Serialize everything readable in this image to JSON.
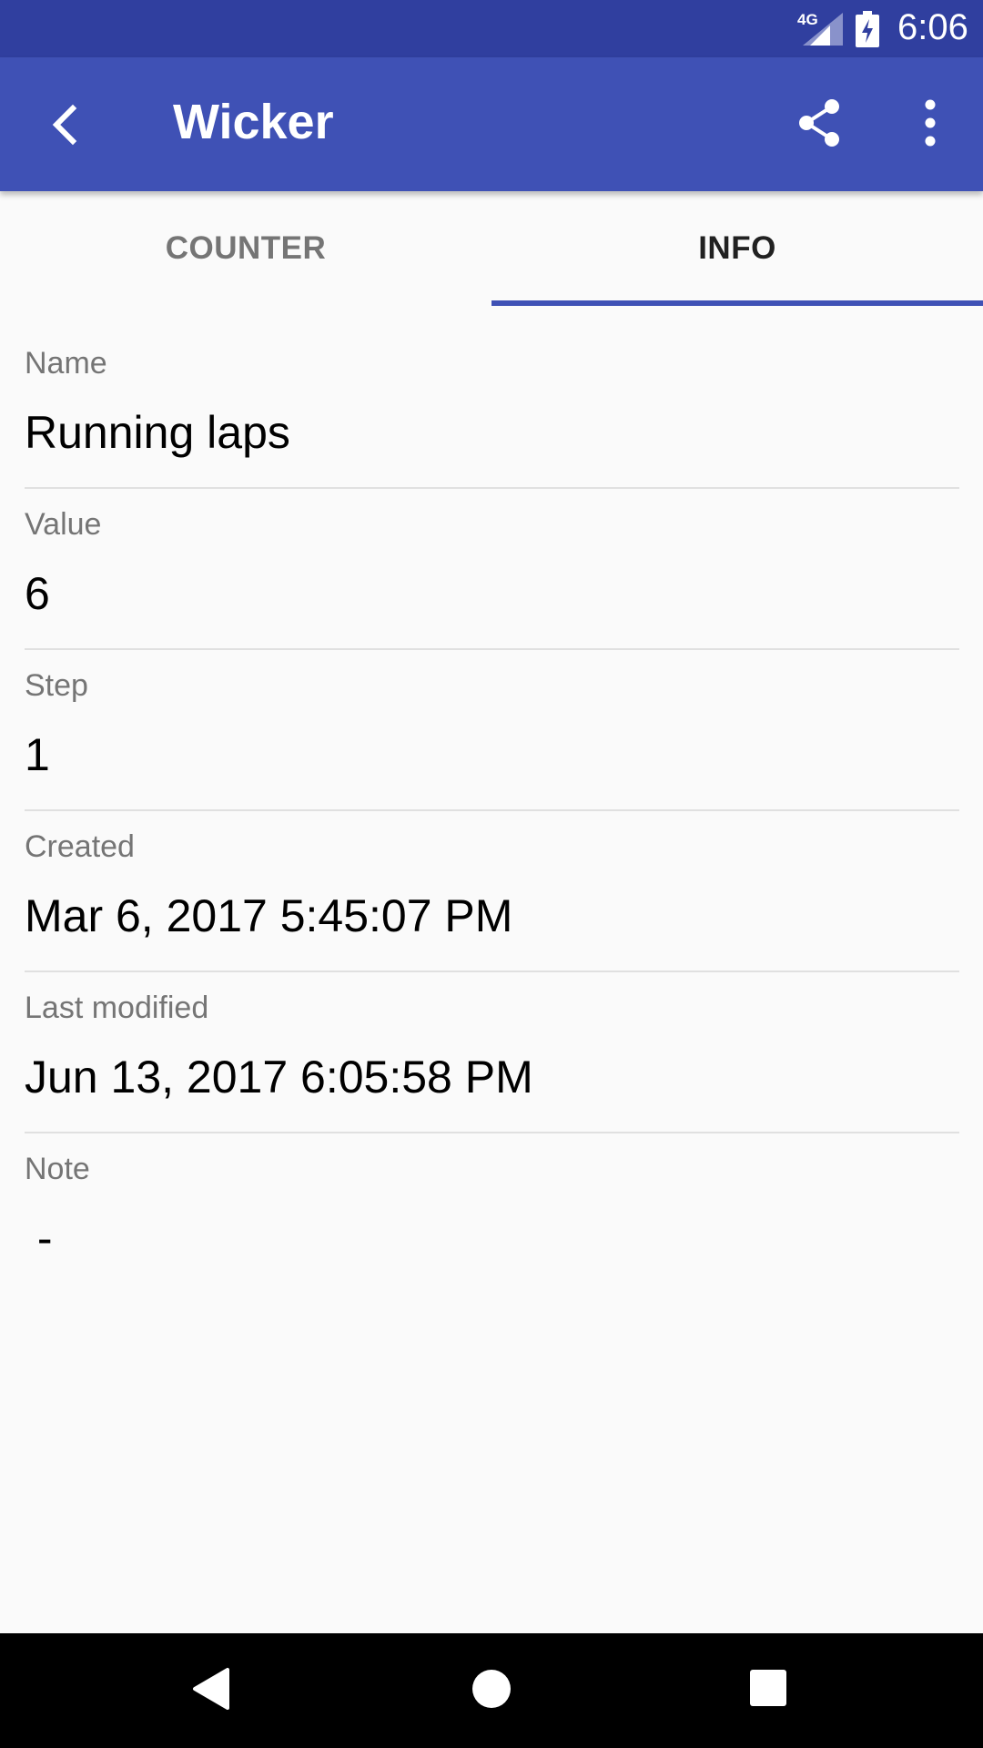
{
  "status_bar": {
    "network_label": "4G",
    "time": "6:06",
    "icons": [
      "signal-icon",
      "battery-charging-icon"
    ]
  },
  "app_bar": {
    "title": "Wicker",
    "icons": [
      "back-arrow-icon",
      "share-icon",
      "more-vert-icon"
    ],
    "background": "#3f51b5"
  },
  "tabs": [
    {
      "label": "COUNTER",
      "selected": false
    },
    {
      "label": "INFO",
      "selected": true
    }
  ],
  "fields": [
    {
      "label": "Name",
      "value": "Running laps"
    },
    {
      "label": "Value",
      "value": "6"
    },
    {
      "label": "Step",
      "value": "1"
    },
    {
      "label": "Created",
      "value": "Mar 6, 2017 5:45:07 PM"
    },
    {
      "label": "Last modified",
      "value": "Jun 13, 2017 6:05:58 PM"
    },
    {
      "label": "Note",
      "value": " -"
    }
  ],
  "nav_bar": {
    "icons": [
      "nav-back-icon",
      "nav-home-icon",
      "nav-recents-icon"
    ]
  },
  "colors": {
    "primary": "#3f51b5",
    "primary_dark": "#303f9f",
    "label_gray": "#757575"
  }
}
